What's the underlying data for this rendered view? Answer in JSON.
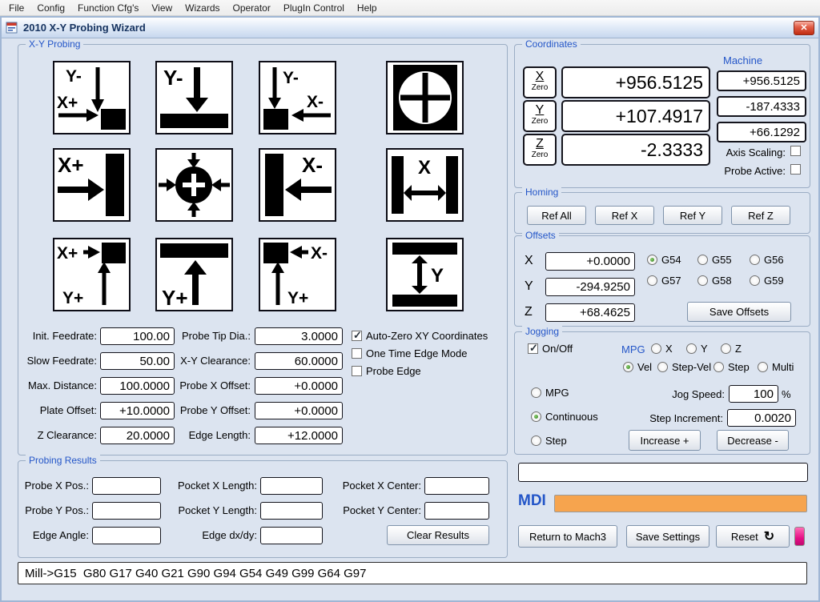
{
  "menu": {
    "items": [
      "File",
      "Config",
      "Function Cfg's",
      "View",
      "Wizards",
      "Operator",
      "PlugIn Control",
      "Help"
    ]
  },
  "window": {
    "title": "2010 X-Y Probing Wizard",
    "close_glyph": "✕"
  },
  "probing": {
    "group_title": "X-Y Probing",
    "icons": {
      "corner_tl": {
        "l1": "Y-",
        "l2": "X+"
      },
      "edge_top": {
        "l1": "Y-"
      },
      "corner_tr": {
        "l1": "Y-",
        "l2": "X-"
      },
      "edge_left": {
        "l1": "X+"
      },
      "edge_right": {
        "l1": "X-"
      },
      "width_x": {
        "l1": "X"
      },
      "corner_bl": {
        "l1": "X+",
        "l2": "Y+"
      },
      "edge_bottom": {
        "l1": "Y+"
      },
      "corner_br": {
        "l1": "X-",
        "l2": "Y+"
      },
      "height_y": {
        "l1": "Y"
      }
    },
    "fields_left": [
      {
        "label": "Init. Feedrate:",
        "value": "100.00"
      },
      {
        "label": "Slow Feedrate:",
        "value": "50.00"
      },
      {
        "label": "Max. Distance:",
        "value": "100.0000"
      },
      {
        "label": "Plate Offset:",
        "value": "+10.0000"
      },
      {
        "label": "Z Clearance:",
        "value": "20.0000"
      }
    ],
    "fields_right": [
      {
        "label": "Probe Tip Dia.:",
        "value": "3.0000"
      },
      {
        "label": "X-Y Clearance:",
        "value": "60.0000"
      },
      {
        "label": "Probe X Offset:",
        "value": "+0.0000"
      },
      {
        "label": "Probe Y Offset:",
        "value": "+0.0000"
      },
      {
        "label": "Edge Length:",
        "value": "+12.0000"
      }
    ],
    "checkboxes": [
      {
        "label": "Auto-Zero XY Coordinates",
        "checked": true
      },
      {
        "label": "One Time Edge Mode",
        "checked": false
      },
      {
        "label": "Probe Edge",
        "checked": false
      }
    ]
  },
  "results": {
    "group_title": "Probing Results",
    "row1": [
      {
        "label": "Probe X Pos.:",
        "value": ""
      },
      {
        "label": "Pocket X Length:",
        "value": ""
      },
      {
        "label": "Pocket X Center:",
        "value": ""
      }
    ],
    "row2": [
      {
        "label": "Probe Y Pos.:",
        "value": ""
      },
      {
        "label": "Pocket Y Length:",
        "value": ""
      },
      {
        "label": "Pocket Y Center:",
        "value": ""
      }
    ],
    "row3": [
      {
        "label": "Edge Angle:",
        "value": ""
      },
      {
        "label": "Edge dx/dy:",
        "value": ""
      }
    ],
    "clear_button": "Clear Results"
  },
  "coordinates": {
    "group_title": "Coordinates",
    "machine_label": "Machine",
    "zero_label": "Zero",
    "axes": [
      {
        "axis": "X",
        "work": "+956.5125",
        "machine": "+956.5125"
      },
      {
        "axis": "Y",
        "work": "+107.4917",
        "machine": "-187.4333"
      },
      {
        "axis": "Z",
        "work": "-2.3333",
        "machine": "+66.1292"
      }
    ],
    "axis_scaling_label": "Axis Scaling:",
    "probe_active_label": "Probe Active:"
  },
  "homing": {
    "group_title": "Homing",
    "buttons": [
      "Ref All",
      "Ref X",
      "Ref Y",
      "Ref Z"
    ]
  },
  "offsets": {
    "group_title": "Offsets",
    "rows": [
      {
        "axis": "X",
        "value": "+0.0000"
      },
      {
        "axis": "Y",
        "value": "-294.9250"
      },
      {
        "axis": "Z",
        "value": "+68.4625"
      }
    ],
    "radios": [
      {
        "label": "G54",
        "selected": true
      },
      {
        "label": "G55",
        "selected": false
      },
      {
        "label": "G56",
        "selected": false
      },
      {
        "label": "G57",
        "selected": false
      },
      {
        "label": "G58",
        "selected": false
      },
      {
        "label": "G59",
        "selected": false
      }
    ],
    "save_button": "Save Offsets"
  },
  "jogging": {
    "group_title": "Jogging",
    "onoff_label": "On/Off",
    "onoff_checked": true,
    "mpg_label": "MPG",
    "axis_radios": [
      {
        "label": "X",
        "selected": false
      },
      {
        "label": "Y",
        "selected": false
      },
      {
        "label": "Z",
        "selected": false
      }
    ],
    "mode_radios": [
      {
        "label": "Vel",
        "selected": true
      },
      {
        "label": "Step-Vel",
        "selected": false
      },
      {
        "label": "Step",
        "selected": false
      },
      {
        "label": "Multi",
        "selected": false
      }
    ],
    "jog_type_radios": [
      {
        "label": "MPG",
        "selected": false
      },
      {
        "label": "Continuous",
        "selected": true
      },
      {
        "label": "Step",
        "selected": false
      }
    ],
    "jog_speed_label": "Jog Speed:",
    "jog_speed_value": "100",
    "jog_speed_unit": "%",
    "step_increment_label": "Step Increment:",
    "step_increment_value": "0.0020",
    "increase_button": "Increase +",
    "decrease_button": "Decrease -"
  },
  "mdi": {
    "label": "MDI"
  },
  "footer": {
    "return_button": "Return to Mach3",
    "save_button": "Save Settings",
    "reset_button": "Reset",
    "reset_icon": "↻"
  },
  "status": {
    "text": "Mill->G15  G80 G17 G40 G21 G90 G94 G54 G49 G99 G64 G97"
  },
  "colors": {
    "accent_blue": "#2456c8",
    "mdi_orange": "#f6a44e",
    "led_pink": "#e60f86",
    "close_red": "#c12c10"
  }
}
